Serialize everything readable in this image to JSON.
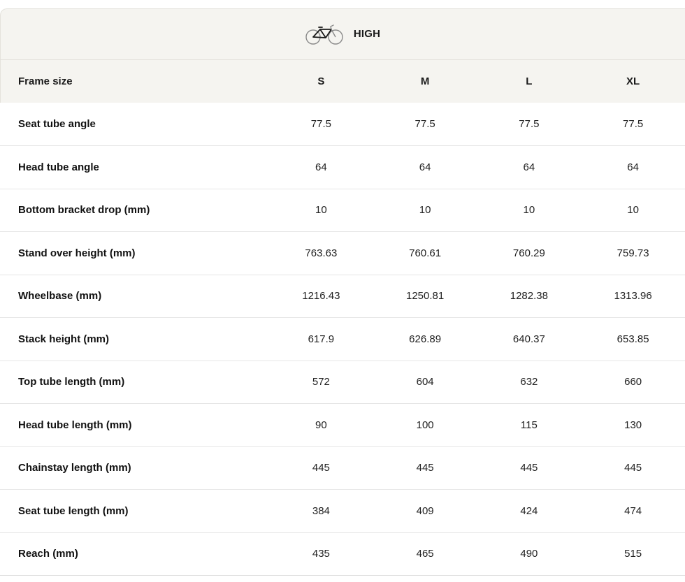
{
  "header": {
    "title": "HIGH",
    "icon": "bicycle-icon"
  },
  "table": {
    "label_header": "Frame size",
    "sizes": [
      "S",
      "M",
      "L",
      "XL"
    ],
    "rows": [
      {
        "label": "Seat tube angle",
        "values": [
          "77.5",
          "77.5",
          "77.5",
          "77.5"
        ]
      },
      {
        "label": "Head tube angle",
        "values": [
          "64",
          "64",
          "64",
          "64"
        ]
      },
      {
        "label": "Bottom bracket drop (mm)",
        "values": [
          "10",
          "10",
          "10",
          "10"
        ]
      },
      {
        "label": "Stand over height (mm)",
        "values": [
          "763.63",
          "760.61",
          "760.29",
          "759.73"
        ]
      },
      {
        "label": "Wheelbase (mm)",
        "values": [
          "1216.43",
          "1250.81",
          "1282.38",
          "1313.96"
        ]
      },
      {
        "label": "Stack height (mm)",
        "values": [
          "617.9",
          "626.89",
          "640.37",
          "653.85"
        ]
      },
      {
        "label": "Top tube length (mm)",
        "values": [
          "572",
          "604",
          "632",
          "660"
        ]
      },
      {
        "label": "Head tube length (mm)",
        "values": [
          "90",
          "100",
          "115",
          "130"
        ]
      },
      {
        "label": "Chainstay length (mm)",
        "values": [
          "445",
          "445",
          "445",
          "445"
        ]
      },
      {
        "label": "Seat tube length (mm)",
        "values": [
          "384",
          "409",
          "424",
          "474"
        ]
      },
      {
        "label": "Reach (mm)",
        "values": [
          "435",
          "465",
          "490",
          "515"
        ]
      }
    ]
  },
  "colors": {
    "header_background": "#f5f4f0",
    "row_border": "#e6e6e6",
    "text": "#1a1a1a",
    "icon_accent": "#1a1a1a",
    "icon_wheel": "#8a8a8a"
  }
}
